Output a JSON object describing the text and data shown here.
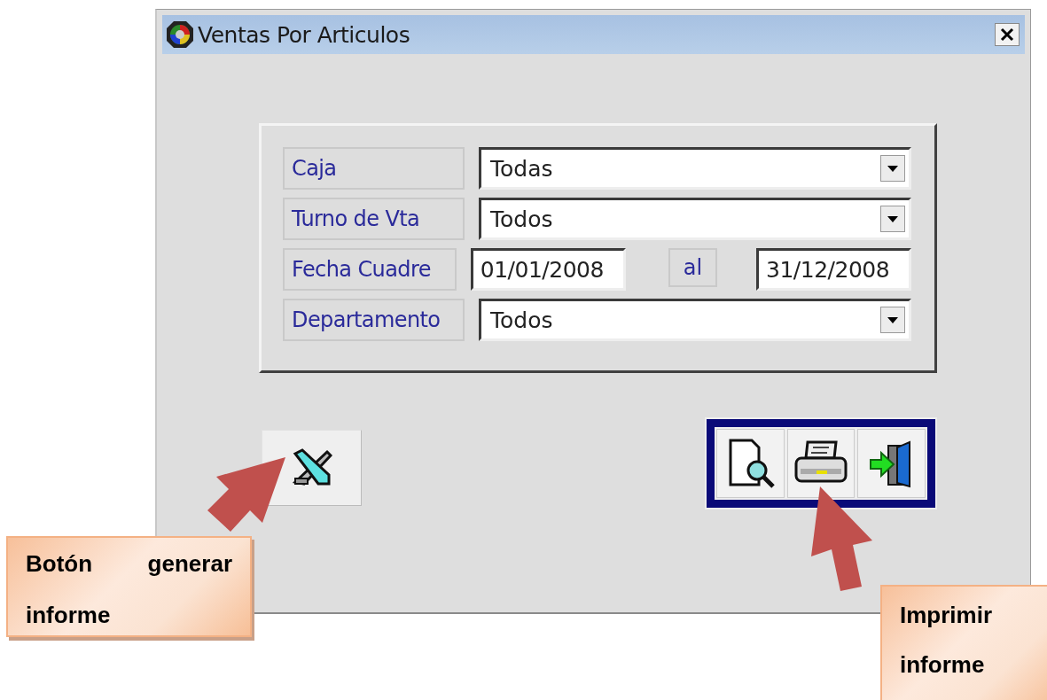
{
  "window": {
    "title": "Ventas Por Articulos"
  },
  "filters": [
    {
      "kind": "select",
      "label": "Caja",
      "value": "Todas"
    },
    {
      "kind": "select",
      "label": "Turno de Vta",
      "value": "Todos"
    },
    {
      "kind": "date_range",
      "label": "Fecha Cuadre",
      "from": "01/01/2008",
      "separator": "al",
      "to": "31/12/2008"
    },
    {
      "kind": "select",
      "label": "Departamento",
      "value": "Todos"
    }
  ],
  "annotations": [
    {
      "text": "Botón generar informe"
    },
    {
      "text": "Imprimir informe"
    }
  ]
}
